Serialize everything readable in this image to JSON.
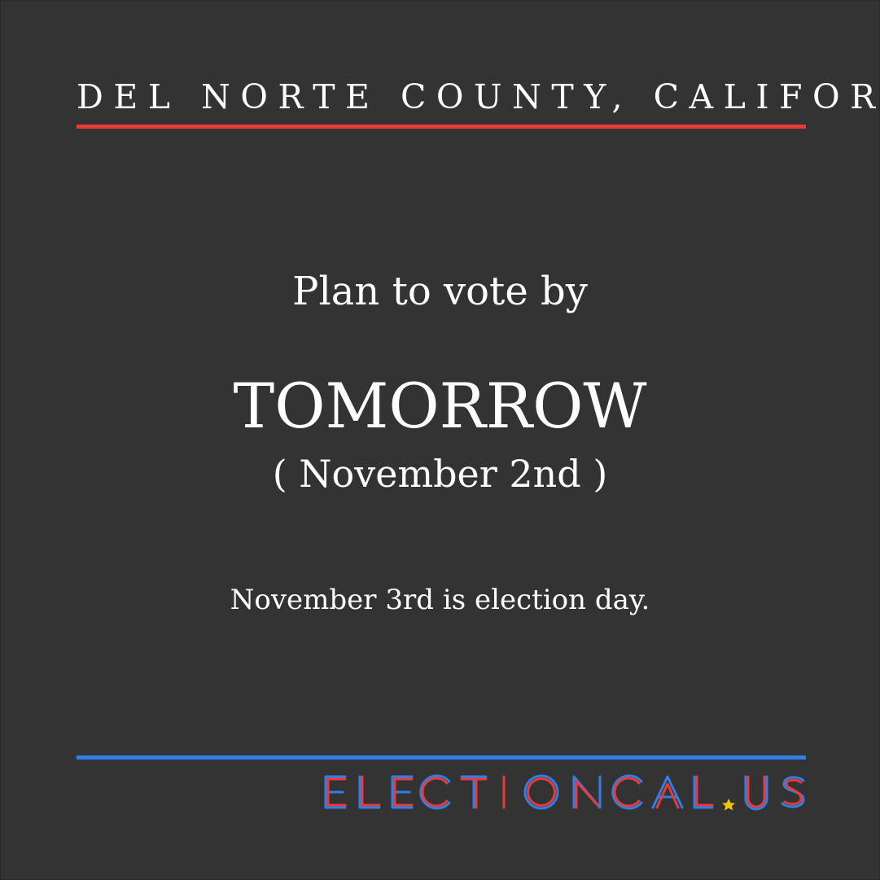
{
  "header": {
    "county": "DEL NORTE COUNTY, CALIFORNIA"
  },
  "message": {
    "lead": "Plan to vote by",
    "deadline": "TOMORROW",
    "date": "( November 2nd )",
    "election_day": "November 3rd is election day."
  },
  "logo": {
    "text": "ELECTIONCAL.US"
  },
  "colors": {
    "background": "#333333",
    "accent_red": "#ea3a3a",
    "accent_blue": "#2f7fe6",
    "star_yellow": "#f2c400",
    "text": "#ffffff"
  }
}
